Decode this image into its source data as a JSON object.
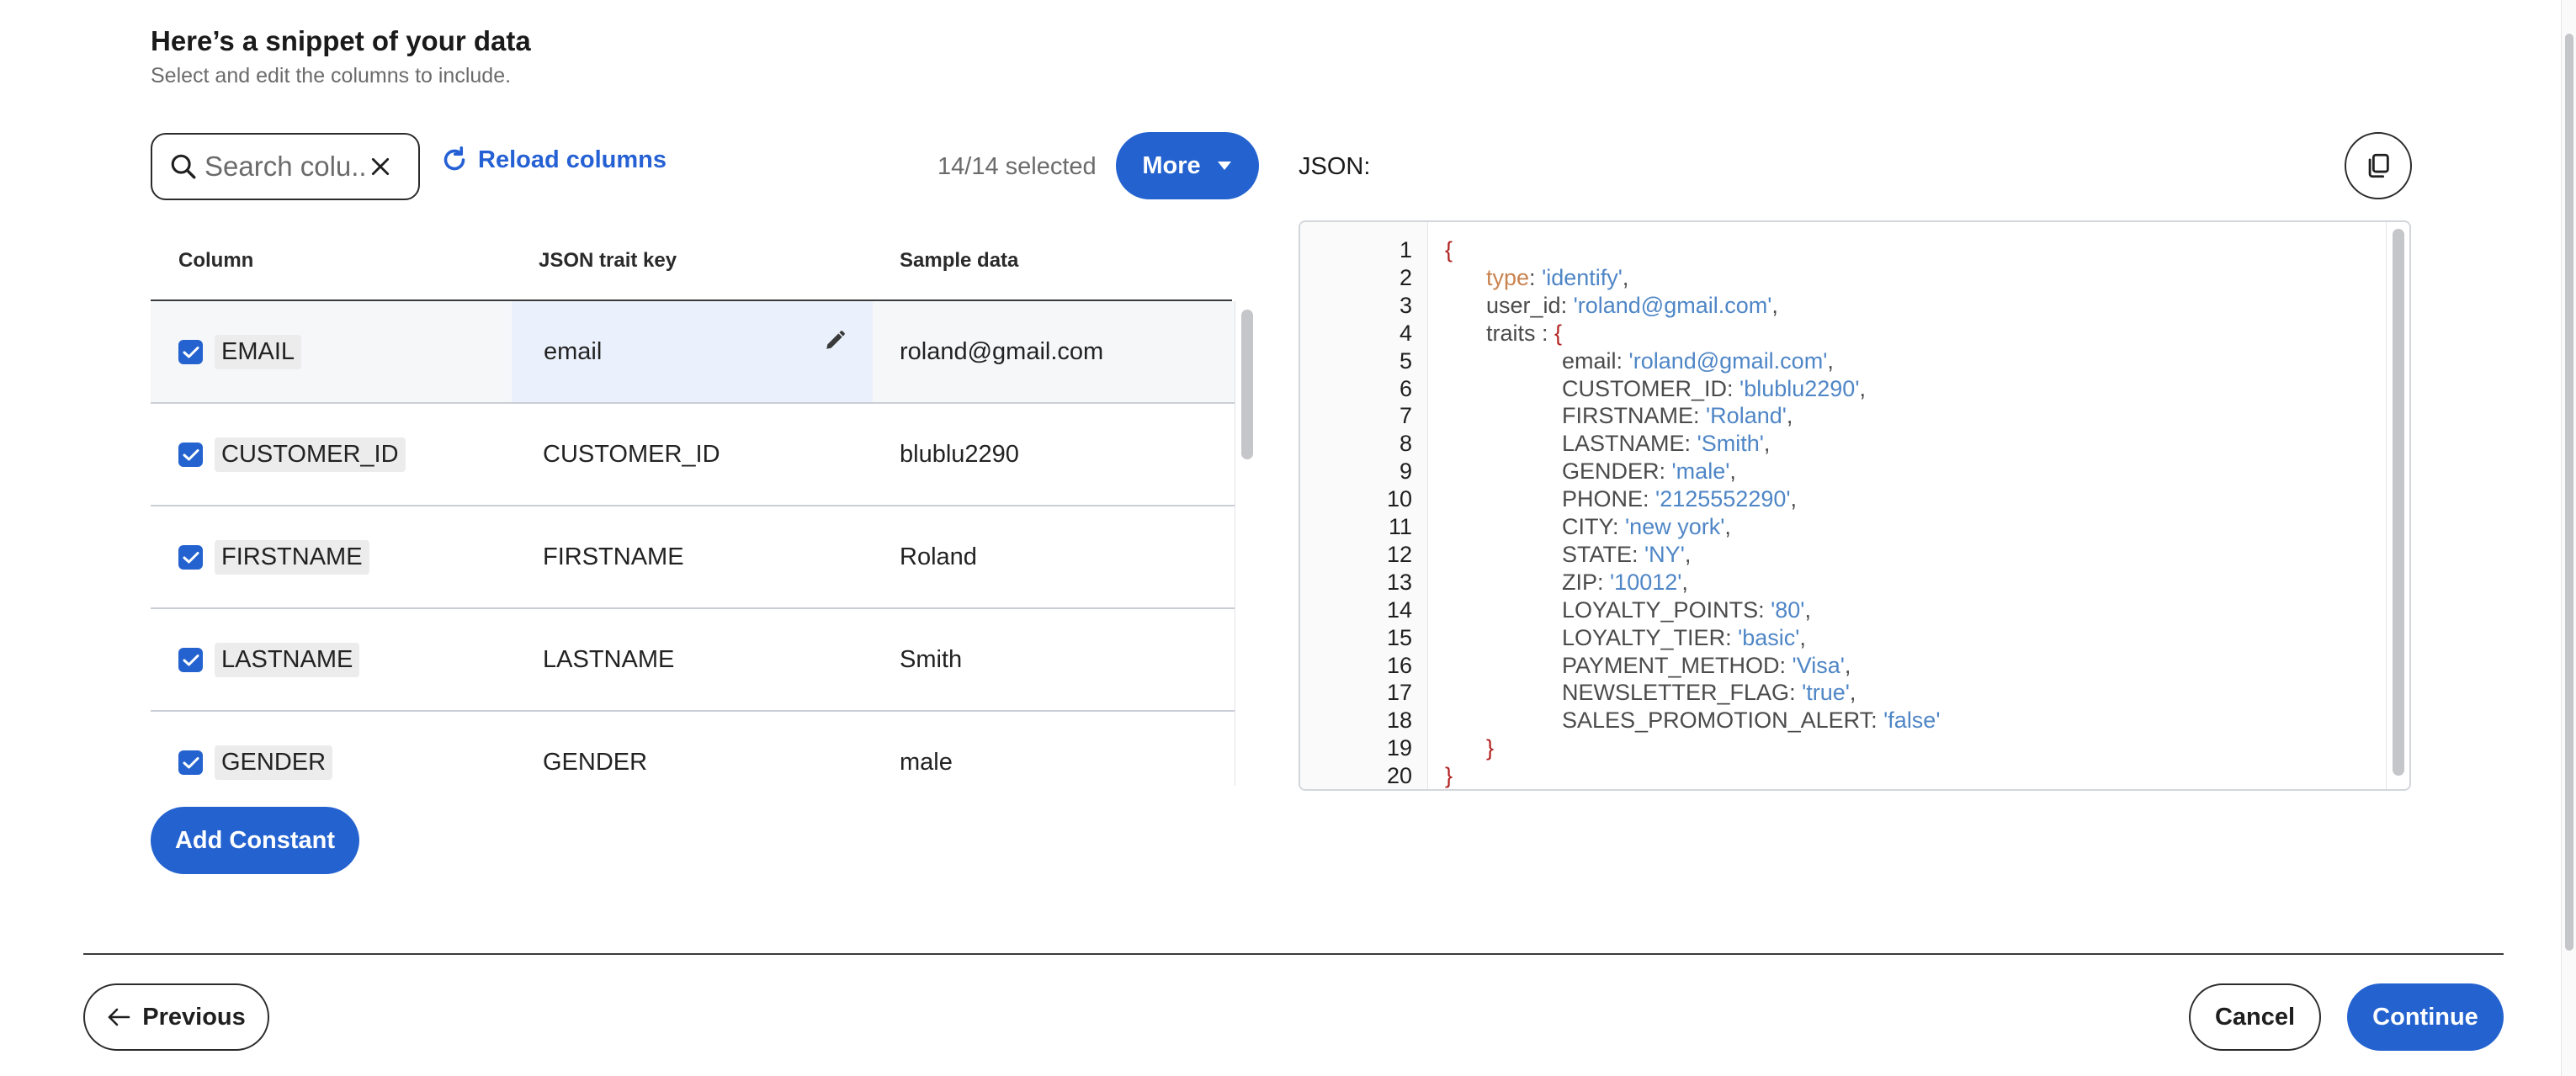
{
  "header": {
    "title": "Here’s a snippet of your data",
    "subtitle": "Select and edit the columns to include."
  },
  "toolbar": {
    "search_placeholder": "Search colu...",
    "search_icon": "search-icon",
    "clear_icon": "close-icon",
    "reload_label": "Reload columns",
    "reload_icon": "refresh-icon",
    "selected_count": "14/14 selected",
    "more_label": "More",
    "more_icon": "caret-down-icon"
  },
  "table": {
    "headers": {
      "column": "Column",
      "trait_key": "JSON trait key",
      "sample": "Sample data"
    },
    "rows": [
      {
        "column": "EMAIL",
        "trait_key": "email",
        "sample": "roland@gmail.com",
        "checked": true,
        "highlighted": true
      },
      {
        "column": "CUSTOMER_ID",
        "trait_key": "CUSTOMER_ID",
        "sample": "blublu2290",
        "checked": true
      },
      {
        "column": "FIRSTNAME",
        "trait_key": "FIRSTNAME",
        "sample": "Roland",
        "checked": true
      },
      {
        "column": "LASTNAME",
        "trait_key": "LASTNAME",
        "sample": "Smith",
        "checked": true
      },
      {
        "column": "GENDER",
        "trait_key": "GENDER",
        "sample": "male",
        "checked": true
      }
    ]
  },
  "add_constant_label": "Add Constant",
  "json_panel": {
    "label": "JSON:",
    "copy_icon": "copy-icon",
    "line_numbers": [
      "1",
      "2",
      "3",
      "4",
      "5",
      "6",
      "7",
      "8",
      "9",
      "10",
      "11",
      "12",
      "13",
      "14",
      "15",
      "16",
      "17",
      "18",
      "19",
      "20"
    ],
    "type_key": "type",
    "type_value": "'identify'",
    "user_id_key": "user_id",
    "user_id_value": "'roland@gmail.com'",
    "traits_key": "traits",
    "traits": [
      {
        "key": "email",
        "value": "'roland@gmail.com'",
        "comma": ","
      },
      {
        "key": "CUSTOMER_ID",
        "value": "'blublu2290'",
        "comma": ","
      },
      {
        "key": "FIRSTNAME",
        "value": "'Roland'",
        "comma": ","
      },
      {
        "key": "LASTNAME",
        "value": "'Smith'",
        "comma": ","
      },
      {
        "key": "GENDER",
        "value": "'male'",
        "comma": ","
      },
      {
        "key": "PHONE",
        "value": "'2125552290'",
        "comma": ","
      },
      {
        "key": "CITY",
        "value": "'new york'",
        "comma": ","
      },
      {
        "key": "STATE",
        "value": "'NY'",
        "comma": ","
      },
      {
        "key": "ZIP",
        "value": "'10012'",
        "comma": ","
      },
      {
        "key": "LOYALTY_POINTS",
        "value": "'80'",
        "comma": ","
      },
      {
        "key": "LOYALTY_TIER",
        "value": "'basic'",
        "comma": ","
      },
      {
        "key": "PAYMENT_METHOD",
        "value": "'Visa'",
        "comma": ","
      },
      {
        "key": "NEWSLETTER_FLAG",
        "value": "'true'",
        "comma": ","
      },
      {
        "key": "SALES_PROMOTION_ALERT",
        "value": "'false'",
        "comma": ""
      }
    ]
  },
  "footer": {
    "previous_label": "Previous",
    "previous_icon": "arrow-left-icon",
    "cancel_label": "Cancel",
    "continue_label": "Continue"
  },
  "colors": {
    "primary": "#2463cf",
    "link": "#2561d4",
    "json_brace": "#b22222",
    "json_string": "#4f86c6",
    "json_type_key": "#c9834f",
    "row_highlight": "#ebf1fc"
  }
}
